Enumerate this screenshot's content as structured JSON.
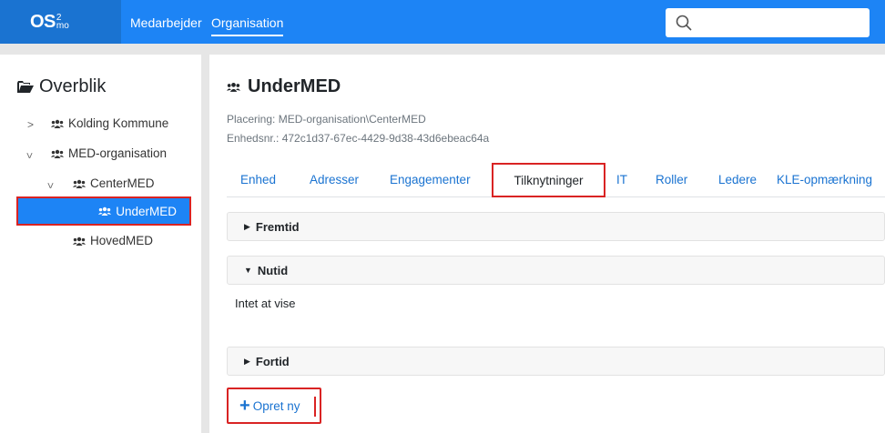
{
  "navbar": {
    "brand_os": "OS",
    "brand_sup": "2",
    "brand_sub": "mo",
    "links": [
      "Medarbejder",
      "Organisation"
    ],
    "active_link": "Organisation",
    "search_placeholder": ""
  },
  "sidebar": {
    "title": "Overblik",
    "tree": [
      {
        "label": "Kolding Kommune",
        "expanded": false
      },
      {
        "label": "MED-organisation",
        "expanded": true
      },
      {
        "label": "CenterMED",
        "expanded": true
      },
      {
        "label": "UnderMED",
        "selected": true
      },
      {
        "label": "HovedMED"
      }
    ]
  },
  "main": {
    "title": "UnderMED",
    "placering": "Placering: MED-organisation\\CenterMED",
    "enhedsnr": "Enhedsnr.: 472c1d37-67ec-4429-9d38-43d6ebeac64a",
    "tabs": [
      "Enhed",
      "Adresser",
      "Engagementer",
      "Tilknytninger",
      "IT",
      "Roller",
      "Ledere",
      "KLE-opmærkning"
    ],
    "active_tab": "Tilknytninger",
    "sections": {
      "fremtid": "Fremtid",
      "nutid": "Nutid",
      "fortid": "Fortid"
    },
    "empty_text": "Intet at vise",
    "create_button": "Opret ny"
  },
  "colors": {
    "navbar": "#1d84f5",
    "brand_bg": "#1a73d1",
    "link": "#1a73d1",
    "highlight": "#d92323",
    "selected_bg": "#1d84f5"
  }
}
